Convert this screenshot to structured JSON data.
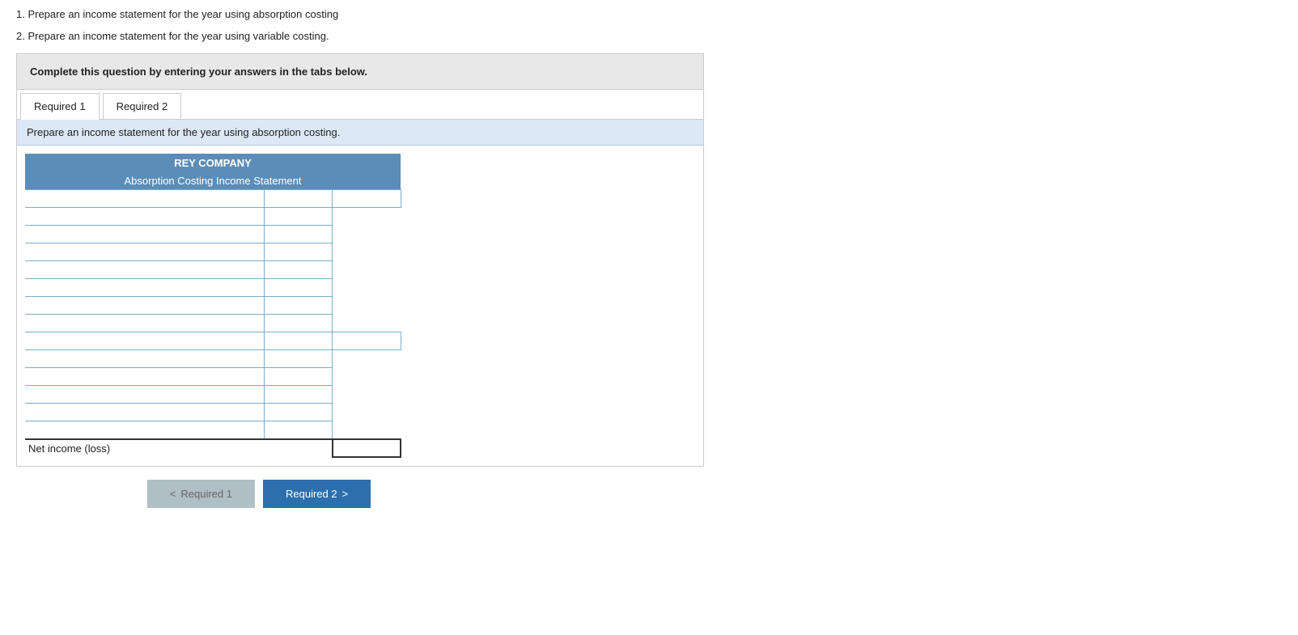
{
  "intro": {
    "line1": "1. Prepare an income statement for the year using absorption costing",
    "line2": "2. Prepare an income statement for the year using variable costing."
  },
  "instruction_box": {
    "text": "Complete this question by entering your answers in the tabs below."
  },
  "tabs": [
    {
      "id": "req1",
      "label": "Required 1",
      "active": true
    },
    {
      "id": "req2",
      "label": "Required 2",
      "active": false
    }
  ],
  "tab_instruction": "Prepare an income statement for the year using absorption costing.",
  "table": {
    "company_name": "REY COMPANY",
    "subtitle": "Absorption Costing Income Statement",
    "rows": [
      {
        "id": "r1",
        "label": "",
        "mid": "",
        "right": "",
        "show_mid": true,
        "show_right": true
      },
      {
        "id": "r2",
        "label": "",
        "mid": "",
        "right": "",
        "show_mid": true,
        "show_right": false
      },
      {
        "id": "r3",
        "label": "",
        "mid": "",
        "right": "",
        "show_mid": true,
        "show_right": false
      },
      {
        "id": "r4",
        "label": "",
        "mid": "",
        "right": "",
        "show_mid": true,
        "show_right": false
      },
      {
        "id": "r5",
        "label": "",
        "mid": "",
        "right": "",
        "show_mid": true,
        "show_right": false
      },
      {
        "id": "r6",
        "label": "",
        "mid": "",
        "right": "",
        "show_mid": true,
        "show_right": false
      },
      {
        "id": "r7",
        "label": "",
        "mid": "",
        "right": "",
        "show_mid": true,
        "show_right": false
      },
      {
        "id": "r8",
        "label": "",
        "mid": "",
        "right": "",
        "show_mid": true,
        "show_right": false
      },
      {
        "id": "r9",
        "label": "",
        "mid": "",
        "right": "",
        "show_mid": true,
        "show_right": true
      },
      {
        "id": "r10",
        "label": "",
        "mid": "",
        "right": "",
        "show_mid": true,
        "show_right": false
      },
      {
        "id": "r11",
        "label": "",
        "mid": "",
        "right": "",
        "show_mid": true,
        "show_right": false
      },
      {
        "id": "r12",
        "label": "",
        "mid": "",
        "right": "",
        "show_mid": true,
        "show_right": false
      },
      {
        "id": "r13",
        "label": "",
        "mid": "",
        "right": "",
        "show_mid": true,
        "show_right": false
      },
      {
        "id": "r14",
        "label": "",
        "mid": "",
        "right": "",
        "show_mid": true,
        "show_right": false
      }
    ],
    "net_income_label": "Net income (loss)",
    "net_income_value": ""
  },
  "buttons": {
    "prev_label": "Required 1",
    "next_label": "Required 2"
  }
}
